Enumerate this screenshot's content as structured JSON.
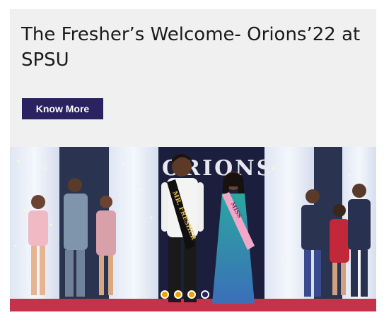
{
  "banner": {
    "title": "The Fresher’s Welcome- Orions’22 at SPSU",
    "cta_label": "Know More",
    "image_description": "",
    "backdrop_text": "ORIONS",
    "sash_left": "MR. FRESHER",
    "sash_right": "MISS"
  },
  "carousel": {
    "slide_count": 4,
    "active_index": 3
  },
  "colors": {
    "accent": "#2b2262",
    "dot_inactive": "#f2a200",
    "card_bg": "#f0f0f0",
    "stage_floor": "#c4334a"
  }
}
